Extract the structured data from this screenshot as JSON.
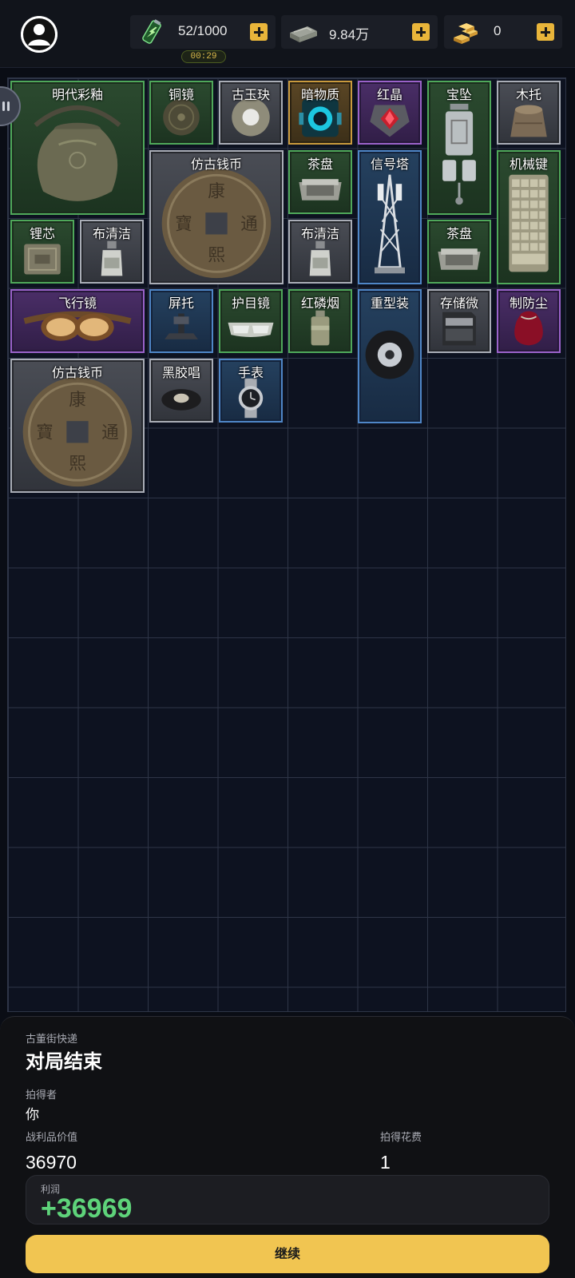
{
  "resources": {
    "energy": {
      "value": "52/1000",
      "icon": "energy-drink-icon"
    },
    "energy_timer": "00:29",
    "cash": {
      "value": "9.84万",
      "icon": "cash-stack-icon"
    },
    "gold": {
      "value": "0",
      "icon": "gold-bars-icon"
    }
  },
  "items": [
    {
      "name": "明代彩釉",
      "rarity": "green",
      "icon": "jar-icon"
    },
    {
      "name": "铜镜",
      "rarity": "green",
      "icon": "bronze-mirror-icon"
    },
    {
      "name": "古玉玦",
      "rarity": "gray",
      "icon": "jade-ring-icon"
    },
    {
      "name": "暗物质",
      "rarity": "gold",
      "icon": "dark-matter-icon"
    },
    {
      "name": "红晶",
      "rarity": "purple",
      "icon": "red-crystal-icon"
    },
    {
      "name": "宝坠",
      "rarity": "green",
      "icon": "pendant-icon"
    },
    {
      "name": "木托",
      "rarity": "gray",
      "icon": "wooden-stand-icon"
    },
    {
      "name": "仿古钱币",
      "rarity": "gray",
      "icon": "coin-icon"
    },
    {
      "name": "茶盘",
      "rarity": "green",
      "icon": "tea-tray-icon"
    },
    {
      "name": "信号塔",
      "rarity": "blue",
      "icon": "signal-tower-icon"
    },
    {
      "name": "机械键",
      "rarity": "green",
      "icon": "keyboard-icon"
    },
    {
      "name": "锂芯",
      "rarity": "green",
      "icon": "battery-icon"
    },
    {
      "name": "布清洁",
      "rarity": "gray",
      "icon": "cleaner-bottle-icon"
    },
    {
      "name": "布清洁",
      "rarity": "gray",
      "icon": "cleaner-bottle-icon"
    },
    {
      "name": "茶盘",
      "rarity": "green",
      "icon": "tea-tray-icon"
    },
    {
      "name": "飞行镜",
      "rarity": "purple",
      "icon": "flight-goggles-icon"
    },
    {
      "name": "屏托",
      "rarity": "blue",
      "icon": "screen-stand-icon"
    },
    {
      "name": "护目镜",
      "rarity": "green",
      "icon": "safety-goggles-icon"
    },
    {
      "name": "红磷烟",
      "rarity": "green",
      "icon": "smoke-grenade-icon"
    },
    {
      "name": "重型装",
      "rarity": "blue",
      "icon": "heavy-wheel-icon"
    },
    {
      "name": "存储微",
      "rarity": "gray",
      "icon": "memory-card-icon"
    },
    {
      "name": "制防尘",
      "rarity": "purple",
      "icon": "dust-bag-icon"
    },
    {
      "name": "仿古钱币",
      "rarity": "gray",
      "icon": "coin-icon"
    },
    {
      "name": "黑胶唱",
      "rarity": "gray",
      "icon": "vinyl-record-icon"
    },
    {
      "name": "手表",
      "rarity": "blue",
      "icon": "wristwatch-icon"
    }
  ],
  "result": {
    "source": "古董街快递",
    "title": "对局结束",
    "winner_label": "拍得者",
    "winner": "你",
    "loot_value_label": "战利品价值",
    "loot_value": "36970",
    "cost_label": "拍得花费",
    "cost": "1",
    "profit_label": "利润",
    "profit": "+36969",
    "profit_color": "#5ed37a",
    "continue_label": "继续"
  },
  "colors": {
    "accent": "#f1c551",
    "rarity_green": "#4fa85a",
    "rarity_gray": "#a9adb6",
    "rarity_blue": "#4f86c7",
    "rarity_purple": "#9a62c9",
    "rarity_gold": "#c99a3d"
  }
}
